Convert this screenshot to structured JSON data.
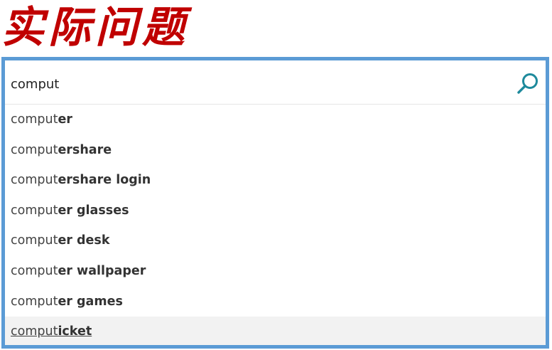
{
  "heading": {
    "title": "实际问题"
  },
  "search": {
    "value": "comput",
    "icon": "search-icon",
    "accent_color": "#1e8a9c"
  },
  "frame_color": "#5b9bd5",
  "suggestions": [
    {
      "typed": "comput",
      "rest": "er",
      "highlighted": false
    },
    {
      "typed": "comput",
      "rest": "ershare",
      "highlighted": false
    },
    {
      "typed": "comput",
      "rest": "ershare login",
      "highlighted": false
    },
    {
      "typed": "comput",
      "rest": "er glasses",
      "highlighted": false
    },
    {
      "typed": "comput",
      "rest": "er desk",
      "highlighted": false
    },
    {
      "typed": "comput",
      "rest": "er wallpaper",
      "highlighted": false
    },
    {
      "typed": "comput",
      "rest": "er games",
      "highlighted": false
    },
    {
      "typed": "comput",
      "rest": "icket",
      "highlighted": true
    }
  ]
}
